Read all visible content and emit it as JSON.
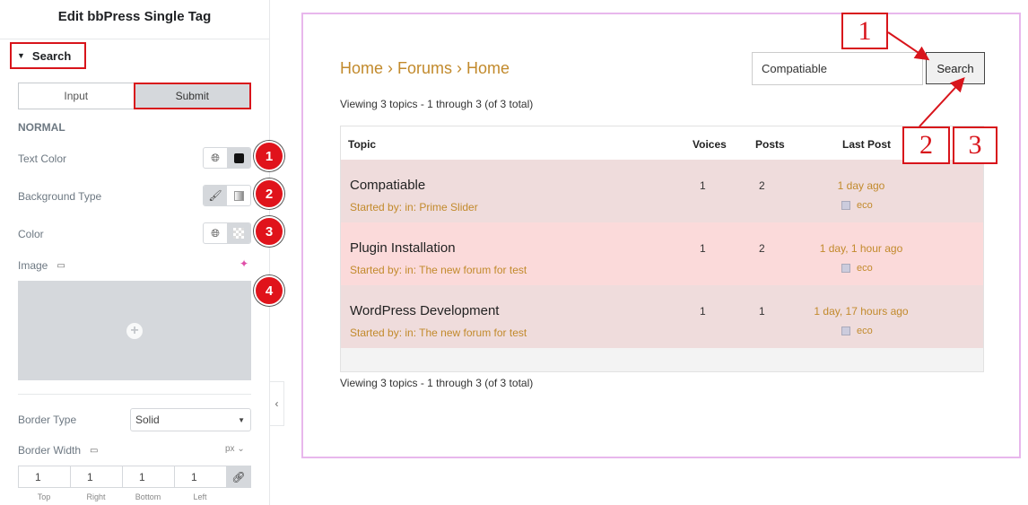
{
  "panel": {
    "title": "Edit bbPress Single Tag",
    "section": "Search",
    "tabs": [
      {
        "label": "Input",
        "active": false
      },
      {
        "label": "Submit",
        "active": true
      }
    ],
    "normal_heading": "NORMAL",
    "text_color_label": "Text Color",
    "background_type_label": "Background Type",
    "color_label": "Color",
    "image_label": "Image",
    "border_type_label": "Border Type",
    "border_type_value": "Solid",
    "border_width_label": "Border Width",
    "unit": "px",
    "dimensions": [
      {
        "value": "1",
        "label": "Top"
      },
      {
        "value": "1",
        "label": "Right"
      },
      {
        "value": "1",
        "label": "Bottom"
      },
      {
        "value": "1",
        "label": "Left"
      }
    ],
    "badges": [
      "1",
      "2",
      "3",
      "4"
    ]
  },
  "preview": {
    "breadcrumb": "Home › Forums › Home",
    "search_value": "Compatiable",
    "search_button": "Search",
    "viewing_text": "Viewing 3 topics - 1 through 3 (of 3 total)",
    "columns": {
      "topic": "Topic",
      "voices": "Voices",
      "posts": "Posts",
      "last_post": "Last Post"
    },
    "rows": [
      {
        "title": "Compatiable",
        "meta": "Started by: in: Prime Slider",
        "voices": "1",
        "posts": "2",
        "last": "1 day ago",
        "author": "eco",
        "bg": "#efdcdc"
      },
      {
        "title": "Plugin Installation",
        "meta": "Started by: in: The new forum for test",
        "voices": "1",
        "posts": "2",
        "last": "1 day, 1 hour ago",
        "author": "eco",
        "bg": "#fbdada"
      },
      {
        "title": "WordPress Development",
        "meta": "Started by: in: The new forum for test",
        "voices": "1",
        "posts": "1",
        "last": "1 day, 17 hours ago",
        "author": "eco",
        "bg": "#efdcdc"
      }
    ]
  },
  "callouts": [
    "1",
    "2",
    "3"
  ],
  "colors": {
    "accent_red": "#d8141b",
    "link_gold": "#c28a2c",
    "preview_border": "#e8b7ec"
  }
}
